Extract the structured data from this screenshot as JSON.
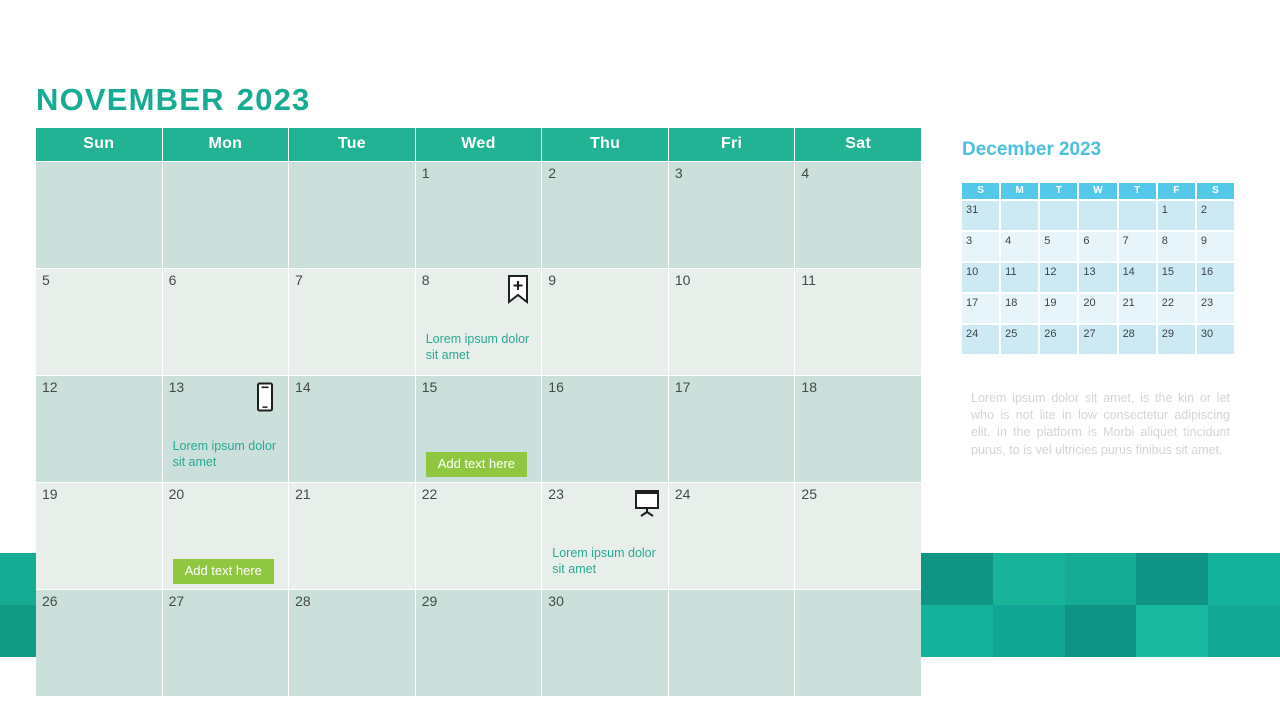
{
  "main": {
    "month": "NOVEMBER",
    "year": "2023",
    "weekday_headers": [
      "Sun",
      "Mon",
      "Tue",
      "Wed",
      "Thu",
      "Fri",
      "Sat"
    ],
    "weeks": [
      {
        "shade": "dark",
        "days": [
          {
            "num": ""
          },
          {
            "num": ""
          },
          {
            "num": ""
          },
          {
            "num": "1"
          },
          {
            "num": "2"
          },
          {
            "num": "3"
          },
          {
            "num": "4"
          }
        ]
      },
      {
        "shade": "light",
        "days": [
          {
            "num": "5"
          },
          {
            "num": "6"
          },
          {
            "num": "7"
          },
          {
            "num": "8",
            "icon": "bookmark-add-icon",
            "note": "Lorem ipsum dolor sit amet"
          },
          {
            "num": "9"
          },
          {
            "num": "10"
          },
          {
            "num": "11"
          }
        ]
      },
      {
        "shade": "dark",
        "days": [
          {
            "num": "12"
          },
          {
            "num": "13",
            "icon": "smartphone-icon",
            "note": "Lorem ipsum dolor sit amet"
          },
          {
            "num": "14"
          },
          {
            "num": "15",
            "button": "Add text here"
          },
          {
            "num": "16"
          },
          {
            "num": "17"
          },
          {
            "num": "18"
          }
        ]
      },
      {
        "shade": "light",
        "days": [
          {
            "num": "19"
          },
          {
            "num": "20",
            "button": "Add text here"
          },
          {
            "num": "21"
          },
          {
            "num": "22"
          },
          {
            "num": "23",
            "icon": "projector-screen-icon",
            "note": "Lorem ipsum dolor sit amet"
          },
          {
            "num": "24"
          },
          {
            "num": "25"
          }
        ]
      },
      {
        "shade": "dark",
        "days": [
          {
            "num": "26"
          },
          {
            "num": "27"
          },
          {
            "num": "28"
          },
          {
            "num": "29"
          },
          {
            "num": "30"
          },
          {
            "num": ""
          },
          {
            "num": ""
          }
        ]
      }
    ]
  },
  "mini": {
    "month": "December",
    "year": "2023",
    "weekday_headers": [
      "S",
      "M",
      "T",
      "W",
      "T",
      "F",
      "S"
    ],
    "weeks": [
      {
        "shade": "dark",
        "days": [
          "31",
          "",
          "",
          "",
          "",
          "1",
          "2"
        ]
      },
      {
        "shade": "light",
        "days": [
          "3",
          "4",
          "5",
          "6",
          "7",
          "8",
          "9"
        ]
      },
      {
        "shade": "dark",
        "days": [
          "10",
          "11",
          "12",
          "13",
          "14",
          "15",
          "16"
        ]
      },
      {
        "shade": "light",
        "days": [
          "17",
          "18",
          "19",
          "20",
          "21",
          "22",
          "23"
        ]
      },
      {
        "shade": "dark",
        "days": [
          "24",
          "25",
          "26",
          "27",
          "28",
          "29",
          "30"
        ]
      }
    ],
    "paragraph": "Lorem ipsum dolor sit amet, is the kin or let who is not lite  in low consectetur adipiscing elit. In the platform is Morbi aliquet tincidunt purus, to is vel ultricies purus finibus sit amet."
  },
  "colors": {
    "brand_teal": "#16ab93",
    "header_teal": "#21b394",
    "cell_dark": "#cce0db",
    "cell_light": "#e8efeb",
    "note_teal": "#2aa894",
    "button_green": "#8fc740",
    "mini_cyan": "#54c8e8",
    "mini_title_cyan": "#4cc0de",
    "mini_cell_dark": "#cdeaf4",
    "mini_cell_light": "#e7f5fa",
    "paragraph_gray": "#d3d6d7",
    "deco_teal_light": "#16ab93",
    "deco_teal_dark": "#129b85"
  },
  "decoration": {
    "left_squares": [
      "#16ab93",
      "#129b85"
    ],
    "right_tiles": [
      "#109585",
      "#18b49a",
      "#15ab95",
      "#0f9384",
      "#14b29c",
      "#14b29c",
      "#11a593",
      "#0f9384",
      "#17b89e",
      "#13a895"
    ]
  }
}
